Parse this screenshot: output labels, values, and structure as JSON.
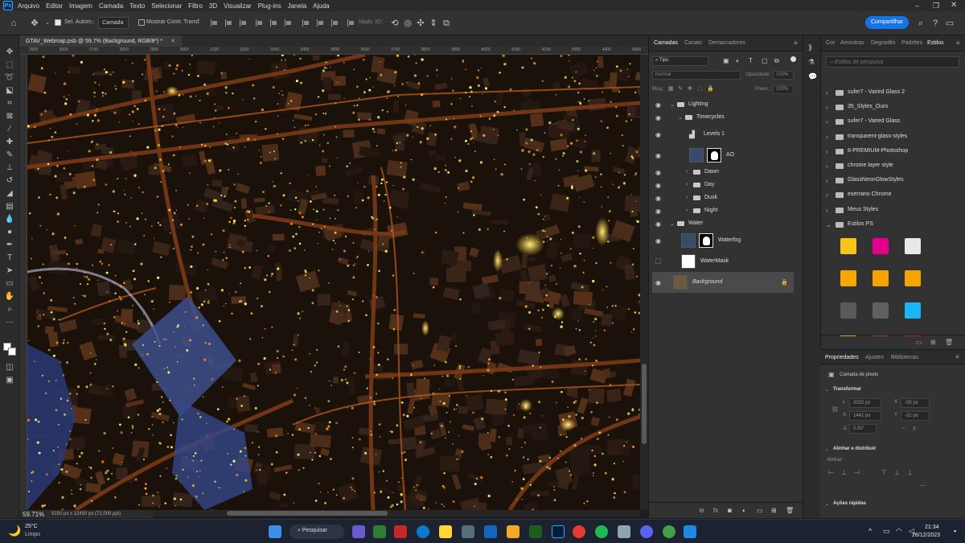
{
  "menubar": {
    "logo": "Ps",
    "items": [
      "Arquivo",
      "Editar",
      "Imagem",
      "Camada",
      "Texto",
      "Selecionar",
      "Filtro",
      "3D",
      "Visualizar",
      "Plug-ins",
      "Janela",
      "Ajuda"
    ]
  },
  "options": {
    "auto_select_label": "Sel. Autom.:",
    "auto_select_value": "Camada",
    "transform_controls_label": "Mostrar Contr. Transf.",
    "mode_3d_label": "Modo 3D:",
    "share_label": "Compartilhar"
  },
  "document": {
    "tab_title": "GTAV_Webmap.psb @ 59,7% (Background, RGB/8*) *",
    "zoom": "59.71%",
    "doc_info": "9150 px x 12450 px (72,009 ppi)",
    "ruler_ticks": [
      "2500",
      "2600",
      "2700",
      "2800",
      "2900",
      "3000",
      "3100",
      "3200",
      "3300",
      "3400",
      "3500",
      "3600",
      "3700",
      "3800",
      "3900",
      "4000",
      "4100",
      "4200",
      "4300",
      "4400",
      "4500"
    ]
  },
  "layers_panel": {
    "tabs": [
      "Camadas",
      "Canais",
      "Demarcadores"
    ],
    "filter_label": "Tipo",
    "blend_mode": "Normal",
    "opacity_label": "Opacidade:",
    "opacity_value": "100%",
    "lock_label": "Bloq.:",
    "fill_label": "Preen.:",
    "fill_value": "100%",
    "layers": [
      {
        "name": "Lighting",
        "kind": "group",
        "indent": 0,
        "visible": true
      },
      {
        "name": "Timecycles",
        "kind": "group",
        "indent": 1,
        "visible": true
      },
      {
        "name": "Levels 1",
        "kind": "adjustment",
        "indent": 2,
        "visible": true
      },
      {
        "name": "AO",
        "kind": "masked",
        "indent": 2,
        "visible": true
      },
      {
        "name": "Dawn",
        "kind": "group",
        "indent": 2,
        "visible": true
      },
      {
        "name": "Day",
        "kind": "group",
        "indent": 2,
        "visible": true
      },
      {
        "name": "Dusk",
        "kind": "group",
        "indent": 2,
        "visible": true
      },
      {
        "name": "Night",
        "kind": "group",
        "indent": 2,
        "visible": true
      },
      {
        "name": "Water",
        "kind": "group",
        "indent": 0,
        "visible": true
      },
      {
        "name": "Waterfog",
        "kind": "masked",
        "indent": 1,
        "visible": true
      },
      {
        "name": "WaterMask",
        "kind": "mask",
        "indent": 1,
        "visible": false
      },
      {
        "name": "Background",
        "kind": "background",
        "indent": 0,
        "visible": true
      }
    ]
  },
  "styles_panel": {
    "tabs": [
      "Cor",
      "Amostras",
      "Degradês",
      "Padrões",
      "Estilos"
    ],
    "search_placeholder": "Estilos de pesquisa",
    "folders": [
      "sufer7 - Varied Glass 2",
      "35_Styles_Ouro",
      "sufer7 - Varied Glass",
      "transparent-glass-styles",
      "8-PREMIUM-Photoshop",
      "chrome layer style",
      "GlassNeonGlowStyles",
      "eserrano Chrome",
      "Meus Styles",
      "Estilos PS"
    ],
    "swatch_colors": [
      "#f5c518",
      "#e3008c",
      "#e8e8e8",
      "#f5a800",
      "#f5a300",
      "#f5a500",
      "#5a5a5a",
      "#606060",
      "#19b8f5"
    ]
  },
  "properties_panel": {
    "tabs": [
      "Propriedades",
      "Ajustes",
      "Bibliotecas"
    ],
    "layer_type": "Camada de pixels",
    "transform_title": "Transformar",
    "w_label": "L",
    "w_value": "2032 px",
    "h_label": "A",
    "h_value": "1441 px",
    "x_label": "X",
    "x_value": "-55 px",
    "y_label": "Y",
    "y_value": "-31 px",
    "angle_value": "0,00°",
    "align_title": "Alinhar e distribuir",
    "align_sub": "Alinhar:",
    "quick_actions": "Ações rápidas"
  },
  "taskbar": {
    "weather_temp": "25°C",
    "weather_desc": "Limpo",
    "search_label": "Pesquisar",
    "time": "21:34",
    "date": "26/12/2023"
  }
}
